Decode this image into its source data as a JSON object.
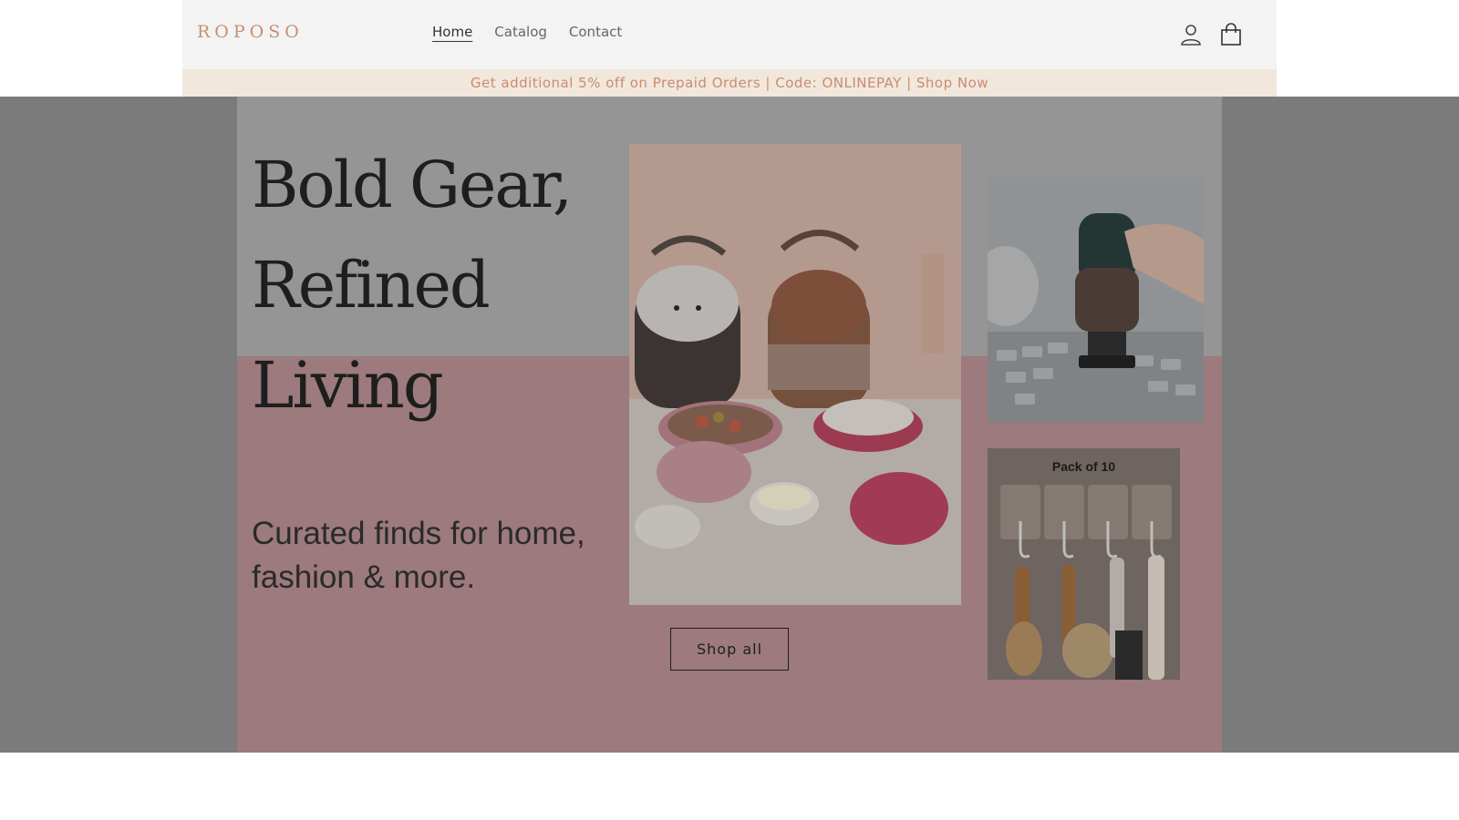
{
  "header": {
    "logo": "ROPOSO",
    "nav": [
      {
        "label": "Home",
        "active": true
      },
      {
        "label": "Catalog",
        "active": false
      },
      {
        "label": "Contact",
        "active": false
      }
    ],
    "icons": [
      "account-icon",
      "cart-icon"
    ]
  },
  "announcement": "Get additional 5% off on Prepaid Orders | Code: ONLINEPAY | Shop Now",
  "hero": {
    "headline_lines": [
      "Bold Gear,",
      "Refined",
      "Living"
    ],
    "subtitle_lines": [
      "Curated finds for home,",
      "fashion & more."
    ],
    "cta": "Shop all",
    "products": {
      "hooks_label": "Pack of 10"
    }
  },
  "colors": {
    "accent": "#c98d70",
    "announcement_bg": "#f1e7dc",
    "header_bg": "#f3f3f3",
    "hero_overlay": "#7b7b7b",
    "hero_pink": "#9c7a7d"
  }
}
